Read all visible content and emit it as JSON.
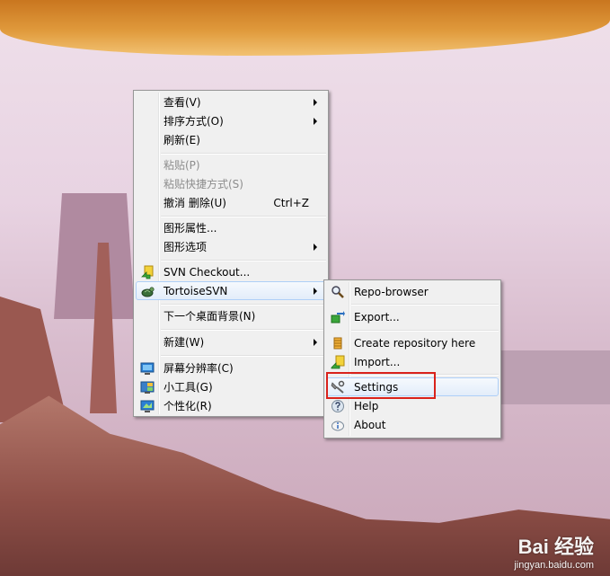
{
  "desktop_menu": {
    "items": [
      {
        "label": "查看(V)",
        "submenu": true
      },
      {
        "label": "排序方式(O)",
        "submenu": true
      },
      {
        "label": "刷新(E)"
      },
      {
        "label": "粘贴(P)",
        "disabled": true
      },
      {
        "label": "粘贴快捷方式(S)",
        "disabled": true
      },
      {
        "label": "撤消 删除(U)",
        "shortcut": "Ctrl+Z"
      },
      {
        "label": "图形属性..."
      },
      {
        "label": "图形选项",
        "submenu": true
      },
      {
        "label": "SVN Checkout...",
        "icon": "svn-checkout-icon"
      },
      {
        "label": "TortoiseSVN",
        "icon": "tortoisesvn-icon",
        "submenu": true,
        "highlighted": true
      },
      {
        "label": "下一个桌面背景(N)"
      },
      {
        "label": "新建(W)",
        "submenu": true
      },
      {
        "label": "屏幕分辨率(C)",
        "icon": "screen-resolution-icon"
      },
      {
        "label": "小工具(G)",
        "icon": "gadgets-icon"
      },
      {
        "label": "个性化(R)",
        "icon": "personalize-icon"
      }
    ]
  },
  "tortoise_submenu": {
    "items": [
      {
        "label": "Repo-browser",
        "icon": "repo-browser-icon"
      },
      {
        "label": "Export...",
        "icon": "export-icon"
      },
      {
        "label": "Create repository here",
        "icon": "create-repository-icon"
      },
      {
        "label": "Import...",
        "icon": "import-icon"
      },
      {
        "label": "Settings",
        "icon": "settings-icon",
        "highlighted": true
      },
      {
        "label": "Help",
        "icon": "help-icon"
      },
      {
        "label": "About",
        "icon": "about-icon"
      }
    ]
  },
  "watermark": {
    "main": "Bai 经验",
    "url": "jingyan.baidu.com"
  },
  "colors": {
    "menu_bg": "#f0f0f0",
    "hover_border": "#aecff7",
    "annotation_red": "#d9221b"
  }
}
